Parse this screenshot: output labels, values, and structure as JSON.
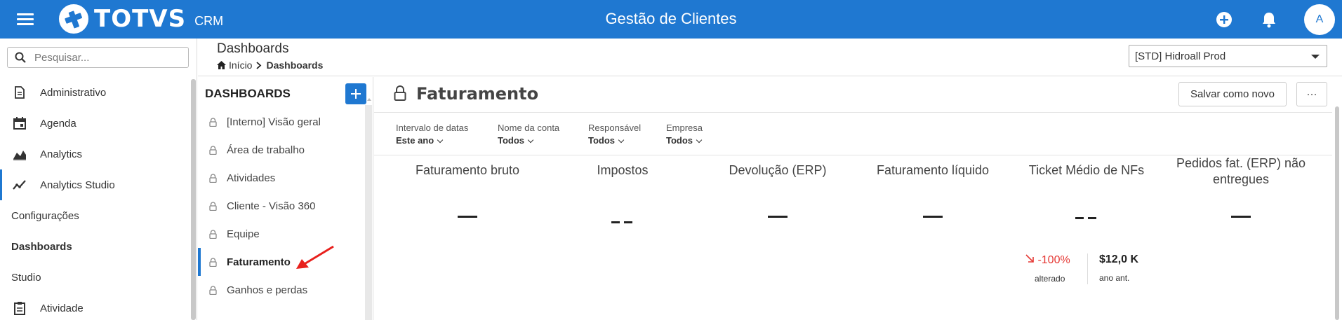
{
  "topbar": {
    "logo_text": "TOTVS",
    "logo_sub": "CRM",
    "title": "Gestão de Clientes",
    "avatar_initial": "A"
  },
  "sidebar": {
    "search_placeholder": "Pesquisar...",
    "items": [
      {
        "label": "Administrativo",
        "icon": "document-icon"
      },
      {
        "label": "Agenda",
        "icon": "calendar-icon"
      },
      {
        "label": "Analytics",
        "icon": "area-chart-icon"
      },
      {
        "label": "Analytics Studio",
        "icon": "trend-icon"
      },
      {
        "label": "Configurações"
      },
      {
        "label": "Dashboards"
      },
      {
        "label": "Studio"
      },
      {
        "label": "Atividade",
        "icon": "clipboard-icon"
      }
    ]
  },
  "header": {
    "title": "Dashboards",
    "breadcrumb_home": "Início",
    "breadcrumb_current": "Dashboards",
    "environment": "[STD] Hidroall Prod"
  },
  "dashboards": {
    "heading": "DASHBOARDS",
    "items": [
      "[Interno] Visão geral",
      "Área de trabalho",
      "Atividades",
      "Cliente - Visão 360",
      "Equipe",
      "Faturamento",
      "Ganhos e perdas"
    ],
    "active": "Faturamento"
  },
  "main": {
    "title": "Faturamento",
    "save_label": "Salvar como novo",
    "more_label": "···",
    "filters": [
      {
        "label": "Intervalo de datas",
        "value": "Este ano"
      },
      {
        "label": "Nome da conta",
        "value": "Todos"
      },
      {
        "label": "Responsável",
        "value": "Todos"
      },
      {
        "label": "Empresa",
        "value": "Todos"
      }
    ],
    "kpis": [
      {
        "title": "Faturamento bruto"
      },
      {
        "title": "Impostos"
      },
      {
        "title": "Devolução (ERP)"
      },
      {
        "title": "Faturamento líquido"
      },
      {
        "title": "Ticket Médio de NFs"
      },
      {
        "title": "Pedidos fat. (ERP) não entregues"
      }
    ],
    "ticket_delta": {
      "pct": "-100%",
      "pct_label": "alterado",
      "prev": "$12,0 K",
      "prev_label": "ano ant."
    }
  },
  "colors": {
    "primary": "#1f78d1",
    "negative": "#e53935"
  }
}
